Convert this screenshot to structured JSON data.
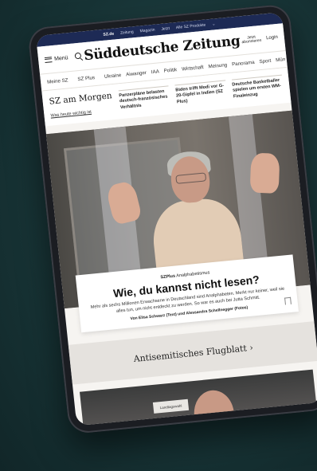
{
  "topbar": {
    "links": [
      "SZ.de",
      "Zeitung",
      "Magazin",
      "Jetzt",
      "Alle SZ Produkte"
    ],
    "active_index": 0,
    "chevron": "chevron-down-icon"
  },
  "header": {
    "menu_label": "Menü",
    "logo": "Süddeutsche Zeitung",
    "abo_line1": "Jetzt",
    "abo_line2": "abonnieren",
    "login_label": "Login"
  },
  "nav": {
    "items": [
      "Meine SZ",
      "SZ Plus",
      "Ukraine",
      "Aiwanger",
      "IAA",
      "Politik",
      "Wirtschaft",
      "Meinung",
      "Panorama",
      "Sport",
      "Mün"
    ]
  },
  "morning": {
    "title": "SZ am Morgen",
    "link": "Was heute wichtig ist",
    "cards": [
      "Panzerpläne belasten deutsch-französisches Verhältnis",
      "Biden trifft Modi vor G-20-Gipfel in Indien (SZ Plus)",
      "Deutsche Basketballer spielen um ersten WM-Finaleinzug"
    ]
  },
  "hero_article": {
    "badge": "SZPlus",
    "kicker": "Analphabetismus",
    "headline": "Wie, du kannst nicht lesen?",
    "teaser": "Mehr als sechs Millionen Erwachsene in Deutschland sind Analphabeten. Merkt nur keiner, weil sie alles tun, um nicht entdeckt zu werden. So war es auch bei Jutta Schmitt.",
    "byline": "Von Elisa Schwarz (Text) und Alessandra Schellnegger (Fotos)"
  },
  "section": {
    "title": "Antisemitisches Flugblatt",
    "chevron": "chevron-right-icon"
  },
  "photo2": {
    "sign": "Landtagswahl"
  }
}
